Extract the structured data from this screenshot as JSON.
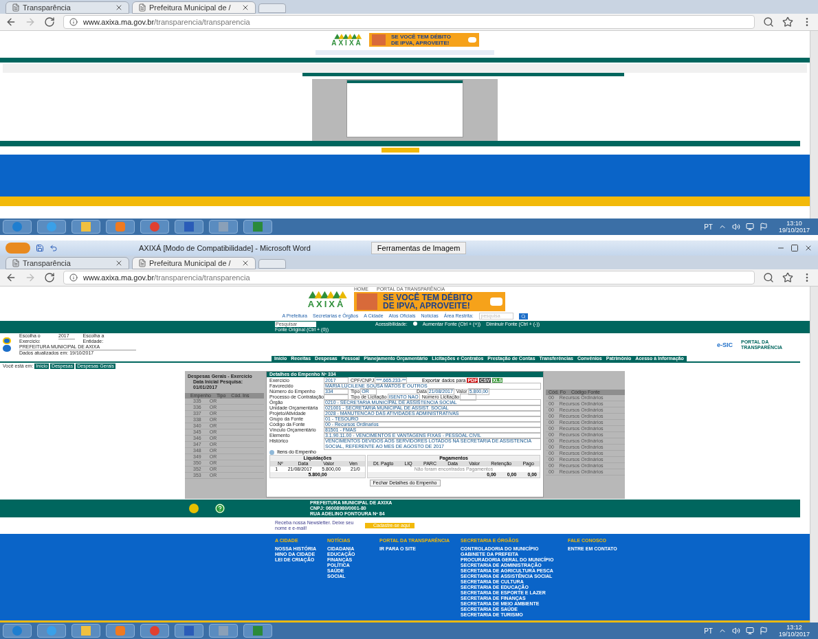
{
  "screens": [
    {
      "browser": {
        "tabs": [
          {
            "label": "Transparência",
            "selected": false
          },
          {
            "label": "Prefeitura Municipal de /",
            "selected": true
          }
        ],
        "url_host": "www.axixa.ma.gov.br",
        "url_path": "/transparencia/transparencia"
      },
      "page": {
        "header": {
          "logo": "AXIXÁ",
          "banner_line1": "SE VOCÊ TEM DÉBITO",
          "banner_line2": "DE IPVA, APROVEITE!"
        }
      },
      "taskbar": {
        "lang": "PT",
        "time": "13:10",
        "date": "19/10/2017"
      }
    },
    {
      "word_window": {
        "title": "AXIXÁ [Modo de Compatibilidade] - Microsoft Word",
        "context_tab": "Ferramentas de Imagem"
      },
      "browser": {
        "tabs": [
          {
            "label": "Transparência",
            "selected": false
          },
          {
            "label": "Prefeitura Municipal de /",
            "selected": true
          }
        ],
        "url_host": "www.axixa.ma.gov.br",
        "url_path": "/transparencia/transparencia"
      },
      "page": {
        "header": {
          "home": "HOME",
          "portal": "PORTAL DA TRANSPARÊNCIA",
          "logo": "AXIXÁ",
          "banner_line1": "SE VOCÊ TEM DÉBITO",
          "banner_line2": "DE IPVA, APROVEITE!"
        },
        "menu": [
          "A Prefeitura",
          "Secretarias e Órgãos",
          "A Cidade",
          "Atos Oficiais",
          "Notícias",
          "Área Restrita:"
        ],
        "menu_search_placeholder": "pesquisa",
        "toolbar": {
          "search": "Pesquisar",
          "original": "Fonte Original (Ctrl + (0))",
          "accessibility": "Acessibilidade:",
          "bigger": "Aumentar Fonte (Ctrl + (+))",
          "smaller": "Diminuir Fonte (Ctrl + (-))"
        },
        "info": {
          "year_label": "Escolha o Exercício:",
          "year": "2017",
          "entity_label": "Escolha a Entidade:",
          "entity": "PREFEITURA MUNICIPAL DE AXIXA",
          "updated": "Dados atualizados em: 19/10/2017",
          "esic": "e-SIC",
          "portal": "PORTAL DA TRANSPARÊNCIA"
        },
        "nav": [
          "Início",
          "Receitas",
          "Despesas",
          "Pessoal",
          "Planejamento Orçamentário",
          "Licitações e Contratos",
          "Prestação de Contas",
          "Transferências",
          "Convênios",
          "Patrimônio",
          "Acesso à Informação"
        ],
        "breadcrumb": {
          "label": "Você está em:",
          "items": [
            "Início",
            "Despesas",
            "Despesas Gerais"
          ]
        },
        "dialog": {
          "bg_title": "Despesas Gerais - Exercício",
          "bg_subtitle": "Data Inicial Pesquisa: 01/01/2017",
          "bg_columns": [
            "Empenho",
            "Tipo",
            "Cód. Ins"
          ],
          "bg_right_columns": [
            "Cód. Fo",
            "Código Fonte"
          ],
          "bg_rows": [
            [
              "335",
              "OR",
              "00",
              "Recursos Ordinários"
            ],
            [
              "336",
              "OR",
              "00",
              "Recursos Ordinários"
            ],
            [
              "337",
              "OR",
              "00",
              "Recursos Ordinários"
            ],
            [
              "338",
              "OR",
              "00",
              "Recursos Ordinários"
            ],
            [
              "340",
              "OR",
              "00",
              "Recursos Ordinários"
            ],
            [
              "345",
              "OR",
              "00",
              "Recursos Ordinários"
            ],
            [
              "346",
              "OR",
              "00",
              "Recursos Ordinários"
            ],
            [
              "347",
              "OR",
              "00",
              "Recursos Ordinários"
            ],
            [
              "348",
              "OR",
              "00",
              "Recursos Ordinários"
            ],
            [
              "349",
              "OR",
              "00",
              "Recursos Ordinários"
            ],
            [
              "350",
              "OR",
              "00",
              "Recursos Ordinários"
            ],
            [
              "352",
              "OR",
              "00",
              "Recursos Ordinários"
            ],
            [
              "353",
              "OR",
              "00",
              "Recursos Ordinários"
            ]
          ],
          "title": "Detalhes do Empenho Nº 334",
          "export_label": "Exportar dados para",
          "exports": [
            "PDF",
            "CSV",
            "XLS"
          ],
          "rows": [
            [
              {
                "label": "Exercício",
                "value": "2017"
              },
              {
                "label": "CPF/CNPJ",
                "value": "***.665.233-**"
              }
            ],
            [
              {
                "label": "Favorecido",
                "value": "MARIA LUCILENE SOUSA MATOS E OUTROS"
              }
            ],
            [
              {
                "label": "Número do Empenho",
                "value": "334"
              },
              {
                "label": "Tipo",
                "value": "OR"
              },
              {
                "label": "Data",
                "value": "21/08/2017"
              },
              {
                "label": "Valor",
                "value": "5.800,00"
              }
            ],
            [
              {
                "label": "Processo de Contratação"
              },
              {
                "label": "Tipo de Licitação",
                "value": "ISENTO NAO"
              },
              {
                "label": "Número Licitação"
              }
            ],
            [
              {
                "label": "Órgão",
                "value": "0210 - SECRETARIA MUNICIPAL DE ASSISTENCIA SOCIAL"
              }
            ],
            [
              {
                "label": "Unidade Orçamentária",
                "value": "021001 - SECRETARIA MUNICIPAL DE ASSIST. SOCIAL"
              }
            ],
            [
              {
                "label": "Projeto/Atividade",
                "value": "2028 - MANUTENCAO DAS ATIVIDADES ADMINISTRATIVAS"
              }
            ],
            [
              {
                "label": "Grupo da Fonte",
                "value": "01 - TESOURO"
              }
            ],
            [
              {
                "label": "Código da Fonte",
                "value": "00 - Recursos Ordinarios"
              }
            ],
            [
              {
                "label": "Vínculo Orçamentário",
                "value": "81501 - FMAS"
              }
            ],
            [
              {
                "label": "Elemento",
                "value": "3.1.90.11.00 - VENCIMENTOS E VANTAGENS FIXAS - PESSOAL CIVIL"
              }
            ],
            [
              {
                "label": "Histórico",
                "value": "VENCIMENTOS DEVIDOS AOS SERVIDORES LOTADOS NA SECRETARIA DE ASSISTENCIA SOCIAL, REFERENTE AO MES DE AGOSTO DE 2017"
              }
            ]
          ],
          "items_label": "Itens do Empenho",
          "liq": {
            "title": "Liquidações",
            "columns": [
              "Nº",
              "Data",
              "Valor",
              "Ven"
            ],
            "row": [
              "1",
              "21/08/2017",
              "5.800,00",
              "21/0"
            ],
            "total": "5.800,00"
          },
          "pag": {
            "title": "Pagamentos",
            "columns": [
              "Dt. Pagto",
              "LIQ",
              "PARC",
              "Data",
              "Valor",
              "Retenção",
              "Pago"
            ],
            "empty": "Não foram encontrados Pagamentos",
            "totals": [
              "0,00",
              "0,00",
              "0,00"
            ]
          },
          "close": "Fechar Detalhes do Empenho"
        },
        "footer": {
          "org": [
            "PREFEITURA MUNICIPAL DE AXIXA",
            "CNPJ: 06008980/0001-80",
            "RUA ADELINO FONTOURA Nº 84"
          ],
          "newsletter": "Receba nossa Newsletter. Deixe seu nome e e-mail!",
          "signup": "Cadastre-se aqui",
          "columns": [
            {
              "title": "A CIDADE",
              "links": [
                "NOSSA HISTÓRIA",
                "HINO DA CIDADE",
                "LEI DE CRIAÇÃO"
              ]
            },
            {
              "title": "NOTÍCIAS",
              "links": [
                "CIDADANIA",
                "EDUCAÇÃO",
                "FINANÇAS",
                "POLÍTICA",
                "SAÚDE",
                "SOCIAL"
              ]
            },
            {
              "title": "PORTAL DA TRANSPARÊNCIA",
              "links": [
                "IR PARA O SITE"
              ]
            },
            {
              "title": "SECRETARIA E ÓRGÃOS",
              "links": [
                "CONTROLADORIA DO MUNICÍPIO",
                "GABINETE DA PREFEITA",
                "PROCURADORIA GERAL DO MUNICÍPIO",
                "SECRETARIA DE ADMINISTRAÇÃO",
                "SECRETARIA DE AGRICULTURA PESCA",
                "SECRETARIA DE ASSISTÊNCIA SOCIAL",
                "SECRETARIA DE CULTURA",
                "SECRETARIA DE EDUCAÇÃO",
                "SECRETARIA DE ESPORTE E LAZER",
                "SECRETARIA DE FINANÇAS",
                "SECRETARIA DE MEIO AMBIENTE",
                "SECRETARIA DE SAÚDE",
                "SECRETARIA DE TURISMO"
              ]
            },
            {
              "title": "FALE CONOSCO",
              "links": [
                "ENTRE EM CONTATO"
              ]
            }
          ]
        }
      },
      "taskbar": {
        "lang": "PT",
        "time": "13:12",
        "date": "19/10/2017"
      }
    }
  ]
}
